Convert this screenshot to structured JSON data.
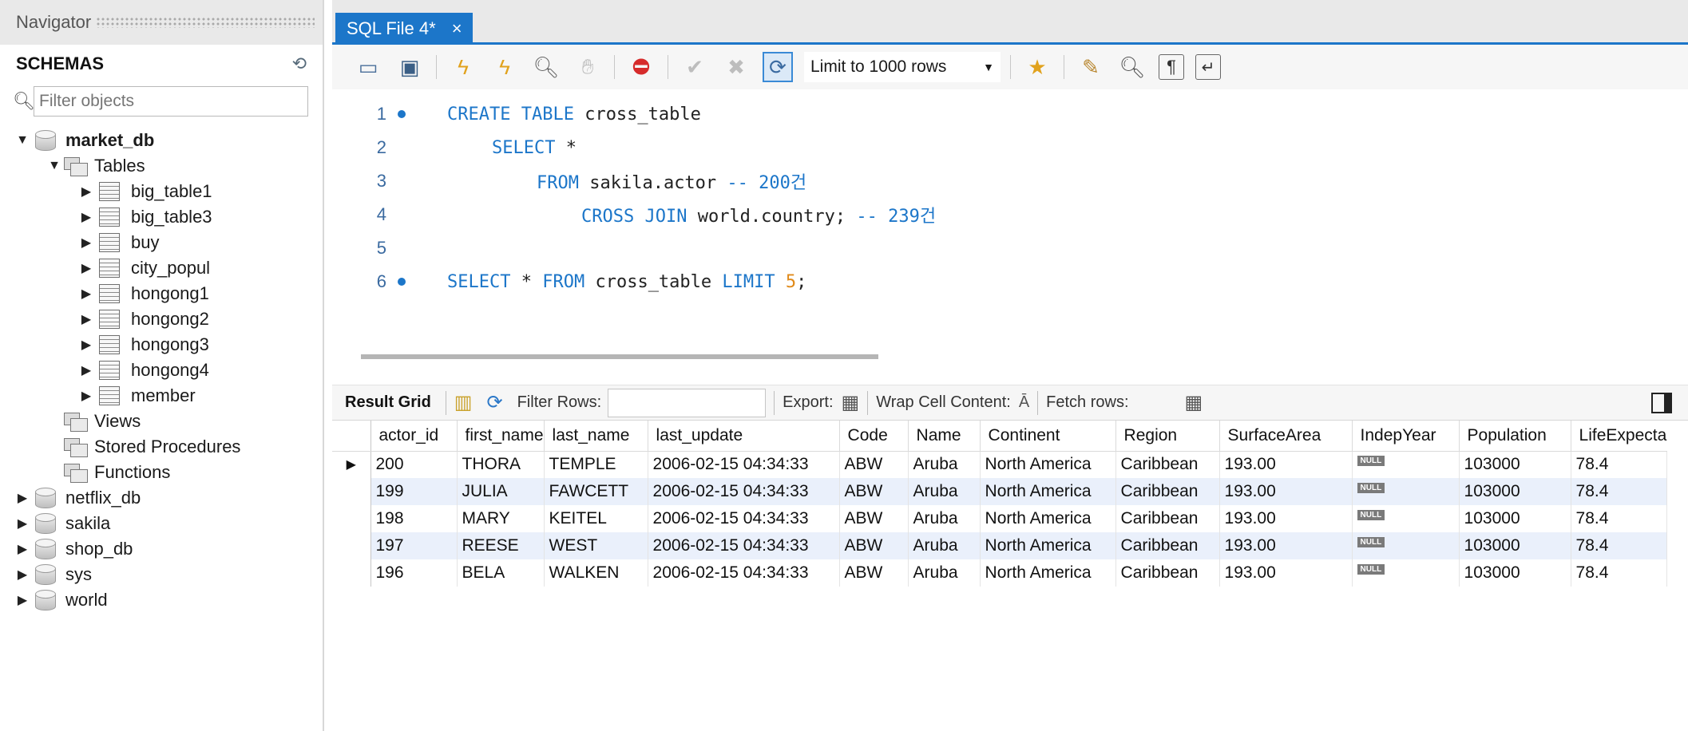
{
  "navigator": {
    "title": "Navigator",
    "schemas_label": "SCHEMAS",
    "filter_placeholder": "Filter objects",
    "tree": {
      "market_db": "market_db",
      "tables": "Tables",
      "table_items": [
        "big_table1",
        "big_table3",
        "buy",
        "city_popul",
        "hongong1",
        "hongong2",
        "hongong3",
        "hongong4",
        "member"
      ],
      "views": "Views",
      "stored_procedures": "Stored Procedures",
      "functions": "Functions",
      "other_dbs": [
        "netflix_db",
        "sakila",
        "shop_db",
        "sys",
        "world"
      ]
    }
  },
  "editor": {
    "tab_label": "SQL File 4*",
    "tab_close": "×",
    "limit_label": "Limit to 1000 rows",
    "lines": [
      {
        "n": "1",
        "breakpoint": true
      },
      {
        "n": "2",
        "breakpoint": false
      },
      {
        "n": "3",
        "breakpoint": false
      },
      {
        "n": "4",
        "breakpoint": false
      },
      {
        "n": "5",
        "breakpoint": false
      },
      {
        "n": "6",
        "breakpoint": true
      }
    ],
    "code": {
      "l1_kw": "CREATE TABLE",
      "l1_id": " cross_table",
      "l2_kw": "SELECT",
      "l2_id": " *",
      "l3_kw": "FROM",
      "l3_id": " sakila.actor ",
      "l3_cm": "-- 200건",
      "l4_kw": "CROSS JOIN",
      "l4_id": " world.country; ",
      "l4_cm": "-- 239건",
      "l6_kw1": "SELECT",
      "l6_id1": " * ",
      "l6_kw2": "FROM",
      "l6_id2": " cross_table ",
      "l6_kw3": "LIMIT",
      "l6_num": " 5",
      "l6_semi": ";"
    }
  },
  "result": {
    "tab_label": "Result Grid",
    "filter_rows_label": "Filter Rows:",
    "export_label": "Export:",
    "wrap_label": "Wrap Cell Content:",
    "fetch_label": "Fetch rows:",
    "null_text": "NULL",
    "columns": [
      "actor_id",
      "first_name",
      "last_name",
      "last_update",
      "Code",
      "Name",
      "Continent",
      "Region",
      "SurfaceArea",
      "IndepYear",
      "Population",
      "LifeExpecta"
    ],
    "rows": [
      [
        "200",
        "THORA",
        "TEMPLE",
        "2006-02-15 04:34:33",
        "ABW",
        "Aruba",
        "North America",
        "Caribbean",
        "193.00",
        "NULL",
        "103000",
        "78.4"
      ],
      [
        "199",
        "JULIA",
        "FAWCETT",
        "2006-02-15 04:34:33",
        "ABW",
        "Aruba",
        "North America",
        "Caribbean",
        "193.00",
        "NULL",
        "103000",
        "78.4"
      ],
      [
        "198",
        "MARY",
        "KEITEL",
        "2006-02-15 04:34:33",
        "ABW",
        "Aruba",
        "North America",
        "Caribbean",
        "193.00",
        "NULL",
        "103000",
        "78.4"
      ],
      [
        "197",
        "REESE",
        "WEST",
        "2006-02-15 04:34:33",
        "ABW",
        "Aruba",
        "North America",
        "Caribbean",
        "193.00",
        "NULL",
        "103000",
        "78.4"
      ],
      [
        "196",
        "BELA",
        "WALKEN",
        "2006-02-15 04:34:33",
        "ABW",
        "Aruba",
        "North America",
        "Caribbean",
        "193.00",
        "NULL",
        "103000",
        "78.4"
      ]
    ]
  },
  "colors": {
    "accent": "#1c76c9",
    "keyword": "#1c76c9",
    "number": "#e08a1a",
    "row_alt": "#eaf0fb"
  }
}
